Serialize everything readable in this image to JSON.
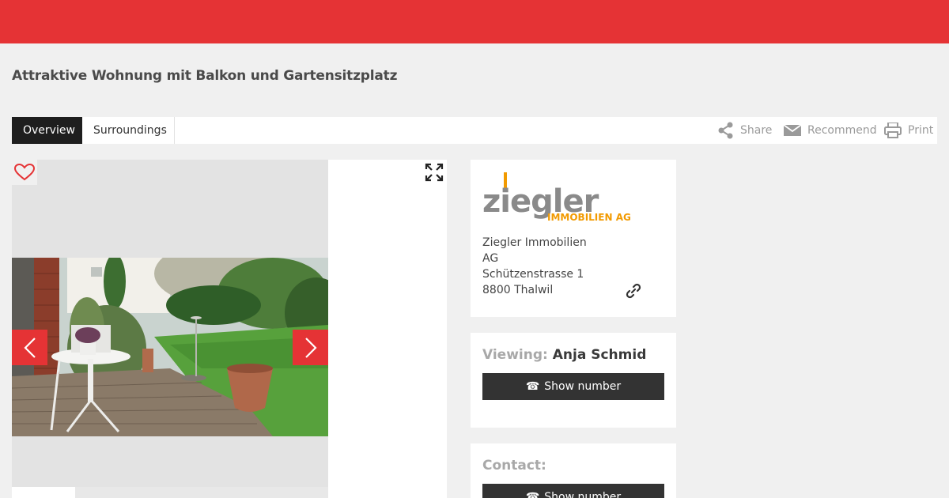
{
  "listing": {
    "title": "Attraktive Wohnung mit Balkon und Gartensitzplatz"
  },
  "tabs": [
    {
      "label": "Overview",
      "active": true
    },
    {
      "label": "Surroundings",
      "active": false
    }
  ],
  "actions": {
    "share": "Share",
    "recommend": "Recommend",
    "print": "Print"
  },
  "gallery": {
    "favorite_icon": "heart-icon",
    "expand_icon": "fullscreen-icon",
    "prev_icon": "chevron-left-icon",
    "next_icon": "chevron-right-icon"
  },
  "agency": {
    "logo_word": "ziegler",
    "logo_sub": "IMMOBILIEN AG",
    "address_lines": [
      "Ziegler Immobilien",
      "AG",
      "Schützenstrasse 1",
      "8800 Thalwil"
    ]
  },
  "viewing": {
    "label": "Viewing:",
    "name": "Anja Schmid",
    "button": "Show number"
  },
  "contact": {
    "label": "Contact:",
    "button": "Show number"
  },
  "colors": {
    "brand_red": "#e53335",
    "logo_grey": "#8a8a8a",
    "logo_orange": "#f29a00"
  }
}
